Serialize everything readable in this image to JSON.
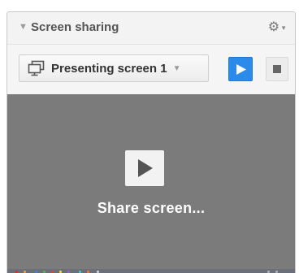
{
  "header": {
    "title": "Screen sharing",
    "collapse_icon": "triangle-down-icon",
    "settings_icon": "gear-icon"
  },
  "toolbar": {
    "screen_select": {
      "icon": "monitor-icon",
      "selected_value": "Presenting screen 1"
    },
    "start_button_icon": "play-icon",
    "stop_button_icon": "stop-icon"
  },
  "preview": {
    "play_icon": "play-icon",
    "action_label": "Share screen..."
  },
  "colors": {
    "accent": "#2a8bea",
    "preview_background": "#7b7b7b",
    "panel_background": "#f5f5f5"
  }
}
